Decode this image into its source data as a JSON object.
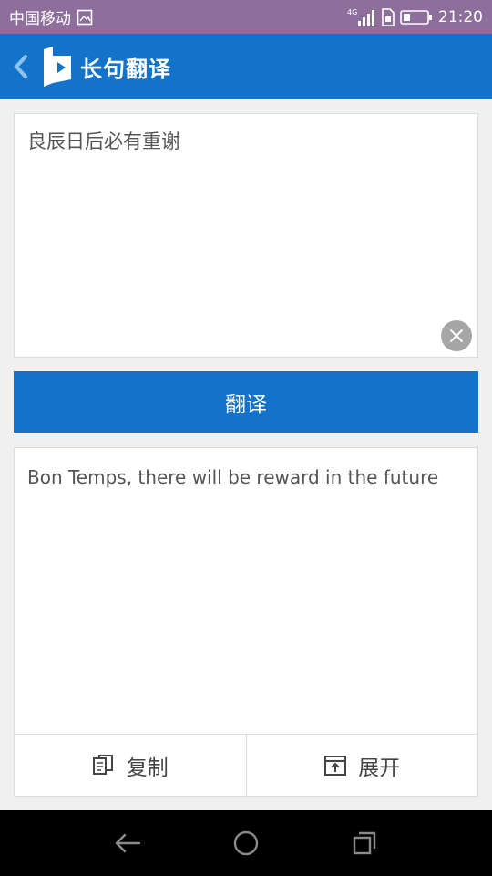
{
  "status_bar": {
    "carrier": "中国移动",
    "network": "4G",
    "time": "21:20"
  },
  "app_bar": {
    "title": "长句翻译"
  },
  "input": {
    "text": "良辰日后必有重谢"
  },
  "translate_button": {
    "label": "翻译"
  },
  "output": {
    "text": "Bon Temps, there will be reward in the future"
  },
  "actions": {
    "copy_label": "复制",
    "expand_label": "展开"
  },
  "colors": {
    "status_bar": "#8e6f9b",
    "primary": "#1273c8",
    "background": "#f0f0f0",
    "nav_bar": "#000000"
  }
}
